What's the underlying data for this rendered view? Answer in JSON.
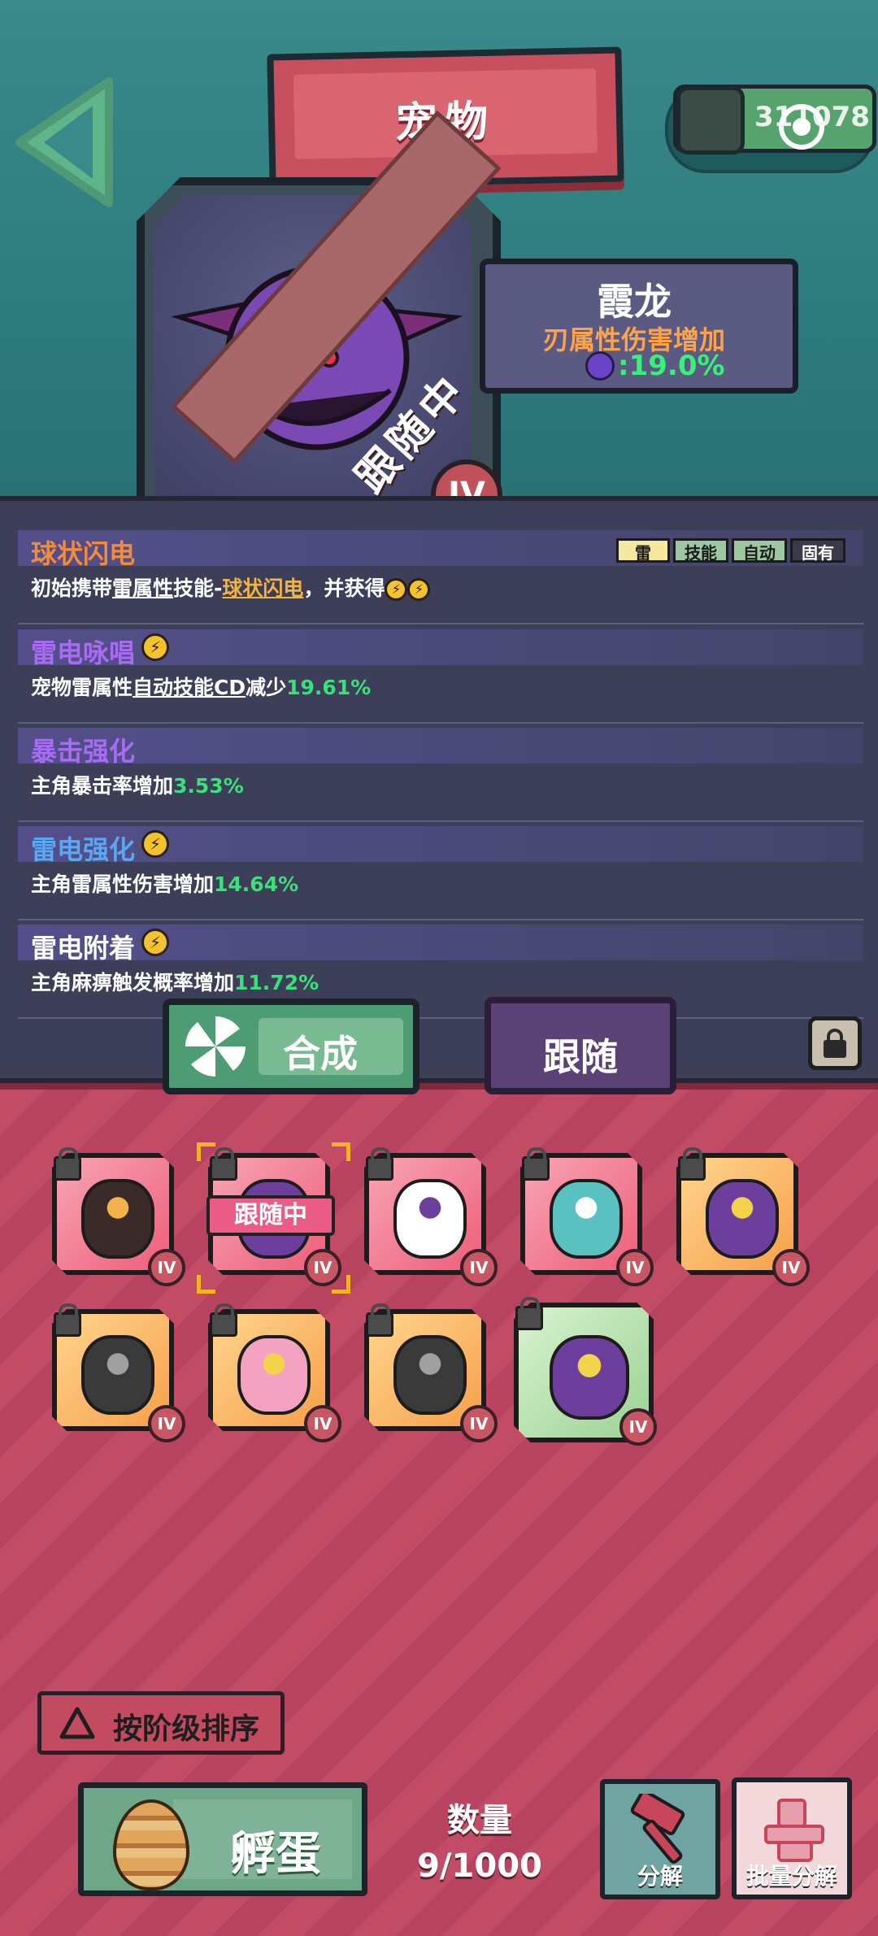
{
  "header": {
    "title": "宠物",
    "currency": "311078"
  },
  "pet": {
    "name": "霞龙",
    "attribute": "刃属性伤害增加",
    "value": ":19.0%",
    "status_ribbon": "跟随中",
    "rank": "IV"
  },
  "skills": [
    {
      "name": "球状闪电",
      "name_color": "#f28b3c",
      "desc_parts": [
        {
          "t": "初始携带",
          "c": ""
        },
        {
          "t": "雷属性",
          "c": "u"
        },
        {
          "t": "技能-",
          "c": ""
        },
        {
          "t": "球状闪电",
          "c": "y"
        },
        {
          "t": "，并获得",
          "c": ""
        }
      ],
      "bolts_after": 2,
      "bolt_after_name": false
    },
    {
      "name": "雷电咏唱",
      "name_color": "#a86cf2",
      "desc_parts": [
        {
          "t": "宠物雷属性",
          "c": ""
        },
        {
          "t": "自动技能CD",
          "c": "u"
        },
        {
          "t": "减少",
          "c": ""
        },
        {
          "t": "19.61%",
          "c": "g"
        }
      ],
      "bolts_after": 0,
      "bolt_after_name": true
    },
    {
      "name": "暴击强化",
      "name_color": "#a86cf2",
      "desc_parts": [
        {
          "t": "主角暴击率增加",
          "c": ""
        },
        {
          "t": "3.53%",
          "c": "g"
        }
      ],
      "bolts_after": 0,
      "bolt_after_name": false
    },
    {
      "name": "雷电强化",
      "name_color": "#5aa7f2",
      "desc_parts": [
        {
          "t": "主角雷属性伤害增加",
          "c": ""
        },
        {
          "t": "14.64%",
          "c": "g"
        }
      ],
      "bolts_after": 0,
      "bolt_after_name": true
    },
    {
      "name": "雷电附着",
      "name_color": "#ffffff",
      "desc_parts": [
        {
          "t": "主角麻痹触发概率增加",
          "c": ""
        },
        {
          "t": "11.72%",
          "c": "g"
        }
      ],
      "bolts_after": 0,
      "bolt_after_name": true
    }
  ],
  "skill_tags": [
    "雷",
    "技能",
    "自动",
    "固有"
  ],
  "tabs": {
    "synth": "合成",
    "follow": "跟随"
  },
  "inventory": {
    "follow_tag": "跟随中",
    "slots": [
      {
        "name": "sword-pet",
        "bg": "red",
        "rank": "IV",
        "art": "#3a2a2a",
        "art2": "#f3b34a"
      },
      {
        "name": "dragon-pet-following",
        "bg": "red",
        "rank": "IV",
        "art": "#6b3f9b",
        "art2": "#f3d34a"
      },
      {
        "name": "skull-pet",
        "bg": "red",
        "rank": "IV",
        "art": "#ffffff",
        "art2": "#6b3f9b"
      },
      {
        "name": "spring-pet",
        "bg": "red",
        "rank": "IV",
        "art": "#5ac0c0",
        "art2": "#ffffff"
      },
      {
        "name": "dragon-pet",
        "bg": "orange",
        "rank": "IV",
        "art": "#6b3f9b",
        "art2": "#f3d34a"
      },
      {
        "name": "drone-pet",
        "bg": "orange",
        "rank": "IV",
        "art": "#3a3a3a",
        "art2": "#a0a0a0"
      },
      {
        "name": "fairy-pet",
        "bg": "orange",
        "rank": "IV",
        "art": "#f3a3c0",
        "art2": "#f3d34a"
      },
      {
        "name": "drone-pet-2",
        "bg": "orange",
        "rank": "IV",
        "art": "#3a3a3a",
        "art2": "#a0a0a0"
      },
      {
        "name": "dragon-pet-green",
        "bg": "green",
        "rank": "IV",
        "art": "#6b3f9b",
        "art2": "#f3d34a"
      }
    ]
  },
  "sort_label": "按阶级排序",
  "hatch_label": "孵蛋",
  "count": {
    "label": "数量",
    "value": "9/1000"
  },
  "decompose_label": "分解",
  "batch_decompose_label": "批量分解",
  "colors": {
    "accent_green": "#3ce07a",
    "ribbon": "#a86768",
    "bottom_bg": "#c24c65"
  }
}
